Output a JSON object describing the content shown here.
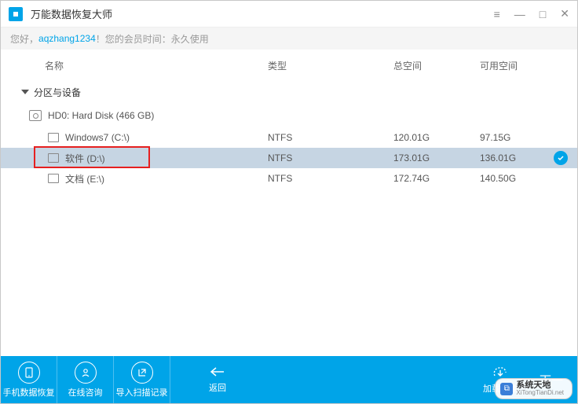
{
  "titlebar": {
    "title": "万能数据恢复大师"
  },
  "greeting": {
    "prefix": "您好，",
    "username": "aqzhang1234",
    "suffix": "！您的会员时间：永久使用"
  },
  "columns": {
    "name": "名称",
    "type": "类型",
    "total": "总空间",
    "free": "可用空间"
  },
  "section": {
    "label": "分区与设备"
  },
  "disk": {
    "label": "HD0: Hard Disk (466 GB)"
  },
  "drives": [
    {
      "name": "Windows7 (C:\\)",
      "type": "NTFS",
      "total": "120.01G",
      "free": "97.15G",
      "selected": false
    },
    {
      "name": "软件 (D:\\)",
      "type": "NTFS",
      "total": "173.01G",
      "free": "136.01G",
      "selected": true
    },
    {
      "name": "文档 (E:\\)",
      "type": "NTFS",
      "total": "172.74G",
      "free": "140.50G",
      "selected": false
    }
  ],
  "footer": {
    "phone": "手机数据恢复",
    "consult": "在线咨询",
    "import": "导入扫描记录",
    "back": "返回",
    "loadimg": "加载镜像",
    "next": "下一"
  },
  "watermark": {
    "cn": "系统天地",
    "en": "XiTongTianDi.net"
  },
  "colors": {
    "accent": "#00a4e8",
    "selected_row": "#c6d5e3",
    "highlight": "#e62020"
  }
}
